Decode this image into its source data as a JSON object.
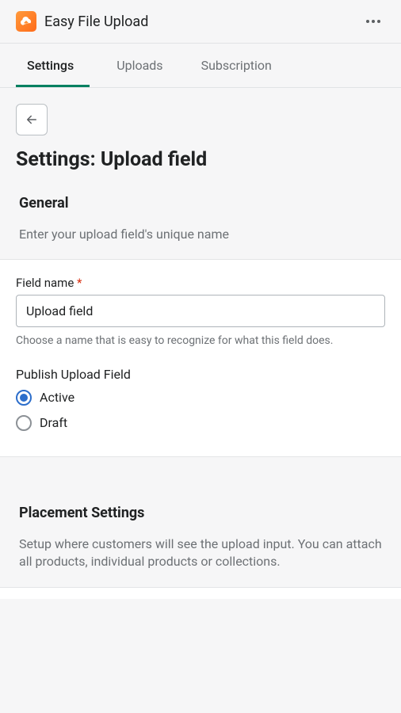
{
  "header": {
    "app_title": "Easy File Upload"
  },
  "tabs": [
    {
      "label": "Settings",
      "active": true
    },
    {
      "label": "Uploads",
      "active": false
    },
    {
      "label": "Subscription",
      "active": false
    }
  ],
  "page": {
    "title": "Settings: Upload field"
  },
  "general": {
    "heading": "General",
    "subtext": "Enter your upload field's unique name",
    "field_name_label": "Field name",
    "field_name_value": "Upload field",
    "field_name_help": "Choose a name that is easy to recognize for what this field does.",
    "publish_label": "Publish Upload Field",
    "options": {
      "active": "Active",
      "draft": "Draft",
      "selected": "active"
    }
  },
  "placement": {
    "heading": "Placement Settings",
    "subtext": "Setup where customers will see the upload input. You can attach all products, individual products or collections."
  },
  "colors": {
    "accent_green": "#008060",
    "accent_blue": "#2c6ecb",
    "danger": "#d72c0d"
  }
}
